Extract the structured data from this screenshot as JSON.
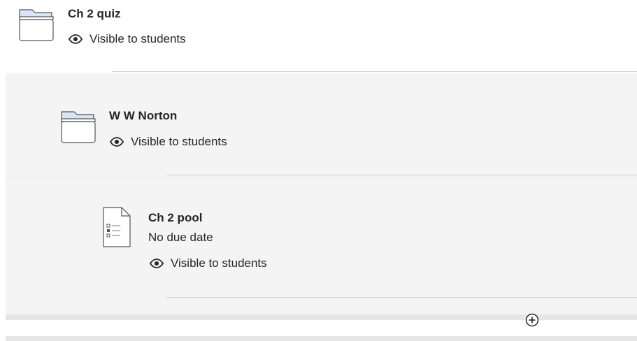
{
  "items": [
    {
      "title": "Ch 2 quiz",
      "visibility": "Visible to students",
      "icon": "folder-icon"
    },
    {
      "title": "W W Norton",
      "visibility": "Visible to students",
      "icon": "folder-icon"
    },
    {
      "title": "Ch 2 pool",
      "due": "No due date",
      "visibility": "Visible to students",
      "icon": "test-document-icon"
    }
  ],
  "add_button_icon": "plus-circle-icon",
  "colors": {
    "folder_tab": "#d7e6f7",
    "panel": "#f4f4f4",
    "divider": "#e6e6e6"
  }
}
